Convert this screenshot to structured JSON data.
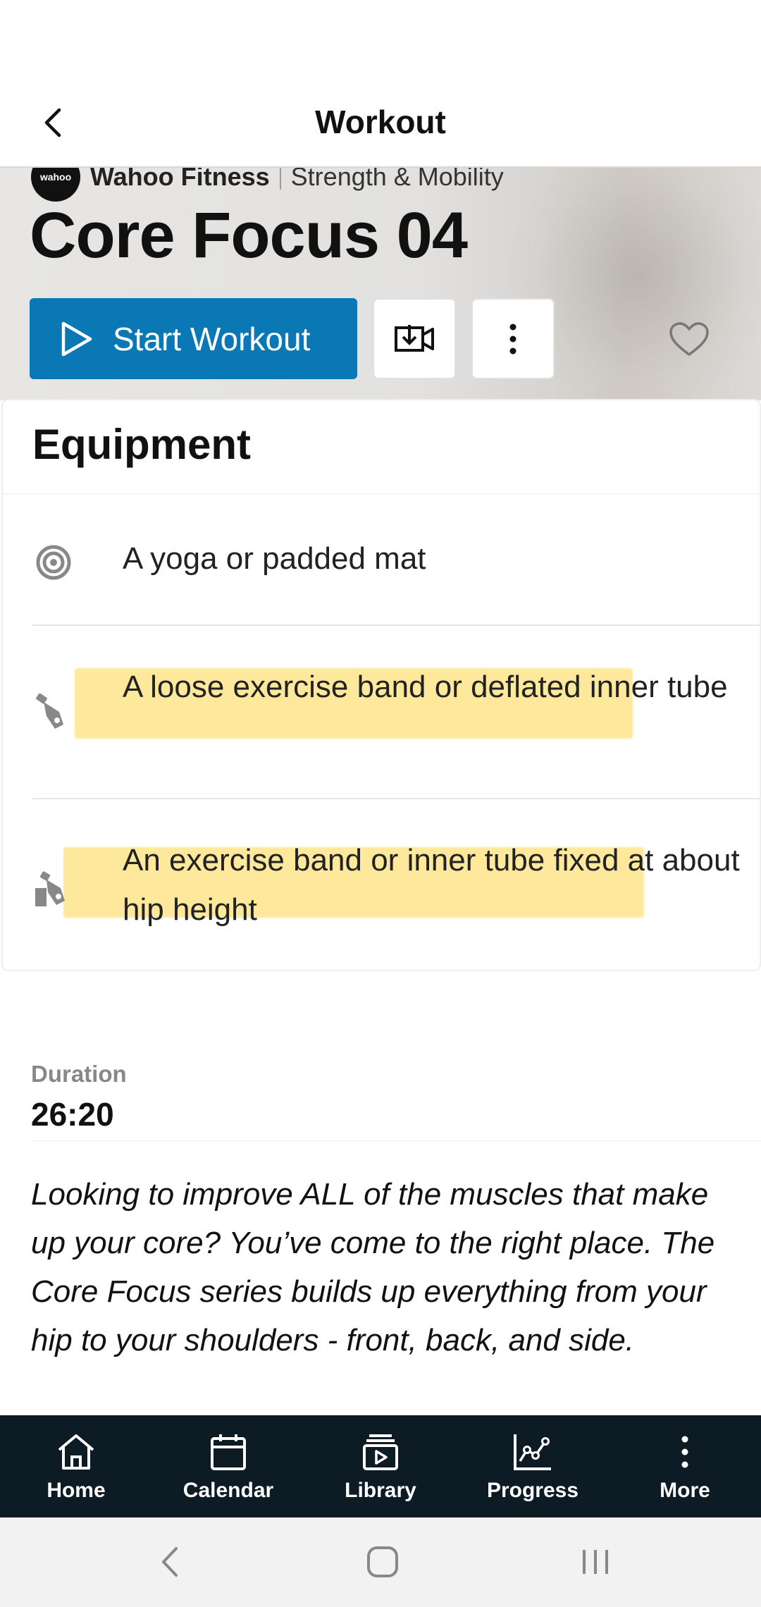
{
  "app_bar": {
    "title": "Workout"
  },
  "hero": {
    "brand_logo_text": "wahoo",
    "brand_name": "Wahoo Fitness",
    "category": "Strength & Mobility",
    "title": "Core Focus 04",
    "start_button": "Start Workout"
  },
  "equipment": {
    "heading": "Equipment",
    "items": [
      {
        "icon": "yoga-mat-icon",
        "label": "A yoga or padded mat"
      },
      {
        "icon": "exercise-band-icon",
        "label": "A loose exercise band or deflated inner tube"
      },
      {
        "icon": "anchored-band-icon",
        "label": "An exercise band or inner tube fixed at about hip height"
      }
    ]
  },
  "details": {
    "duration_label": "Duration",
    "duration_value": "26:20",
    "description": "Looking to improve ALL of the muscles that make up your core? You’ve come to the right place. The Core Focus series builds up everything from your hip to your shoulders - front, back, and side."
  },
  "bottom_nav": [
    {
      "icon": "home-icon",
      "label": "Home"
    },
    {
      "icon": "calendar-icon",
      "label": "Calendar"
    },
    {
      "icon": "library-icon",
      "label": "Library"
    },
    {
      "icon": "progress-icon",
      "label": "Progress"
    },
    {
      "icon": "more-vertical-icon",
      "label": "More"
    }
  ],
  "colors": {
    "primary": "#0a78b4",
    "nav_background": "#0d1b24",
    "highlight": "#fcd648"
  }
}
